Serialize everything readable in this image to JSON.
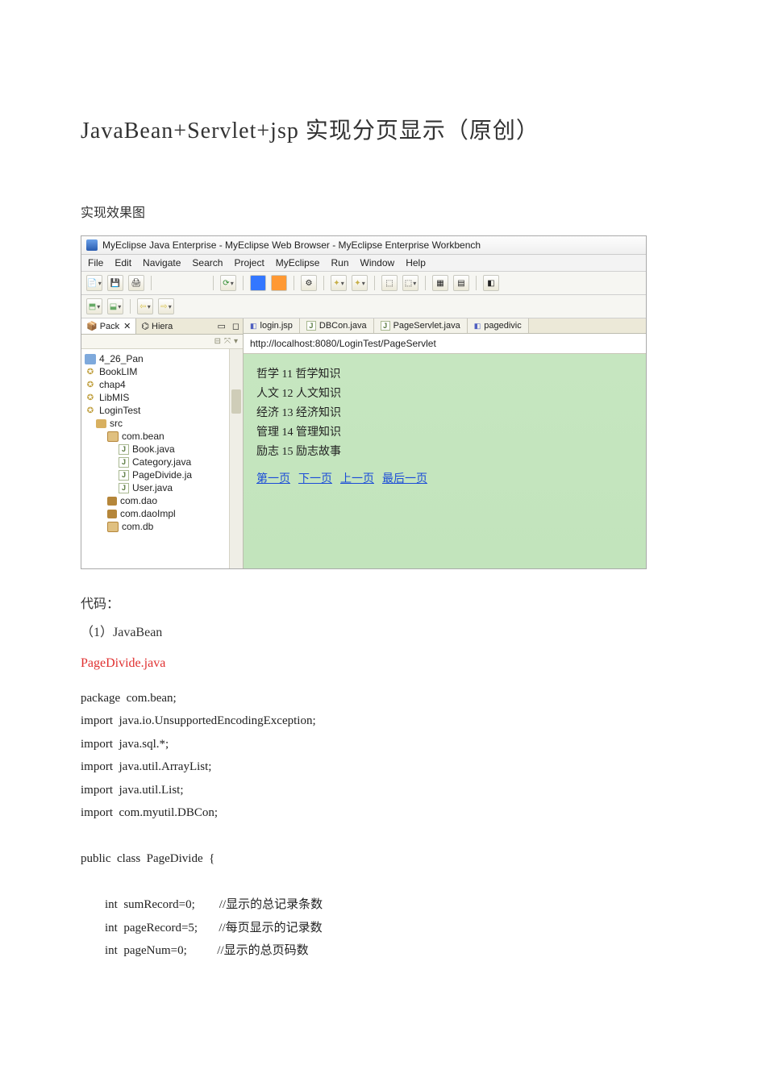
{
  "title": "JavaBean+Servlet+jsp 实现分页显示（原创）",
  "section_effect": "实现效果图",
  "ide": {
    "window_title": "MyEclipse Java Enterprise - MyEclipse Web Browser - MyEclipse Enterprise Workbench",
    "menus": [
      "File",
      "Edit",
      "Navigate",
      "Search",
      "Project",
      "MyEclipse",
      "Run",
      "Window",
      "Help"
    ],
    "left_tabs": {
      "active": "Pack",
      "other": "Hiera"
    },
    "tree": [
      {
        "label": "4_26_Pan",
        "indent": 0,
        "icon": "folder-blue"
      },
      {
        "label": "BookLIM",
        "indent": 0,
        "icon": "proj-icon"
      },
      {
        "label": "chap4",
        "indent": 0,
        "icon": "proj-icon"
      },
      {
        "label": "LibMIS",
        "indent": 0,
        "icon": "proj-icon"
      },
      {
        "label": "LoginTest",
        "indent": 0,
        "icon": "proj-icon"
      },
      {
        "label": "src",
        "indent": 1,
        "icon": "src-icon"
      },
      {
        "label": "com.bean",
        "indent": 2,
        "icon": "pkg-open"
      },
      {
        "label": "Book.java",
        "indent": 3,
        "icon": "java-icon"
      },
      {
        "label": "Category.java",
        "indent": 3,
        "icon": "java-icon"
      },
      {
        "label": "PageDivide.ja",
        "indent": 3,
        "icon": "java-icon"
      },
      {
        "label": "User.java",
        "indent": 3,
        "icon": "java-icon"
      },
      {
        "label": "com.dao",
        "indent": 2,
        "icon": "pkg-brown"
      },
      {
        "label": "com.daoImpl",
        "indent": 2,
        "icon": "pkg-brown"
      },
      {
        "label": "com.db",
        "indent": 2,
        "icon": "pkg-open"
      }
    ],
    "editor_tabs": [
      {
        "label": "login.jsp",
        "kind": "jsp"
      },
      {
        "label": "DBCon.java",
        "kind": "java"
      },
      {
        "label": "PageServlet.java",
        "kind": "java"
      },
      {
        "label": "pagedivic",
        "kind": "jsp"
      }
    ],
    "url": "http://localhost:8080/LoginTest/PageServlet",
    "page_rows": [
      "哲学 11 哲学知识",
      "人文 12 人文知识",
      "经济 13 经济知识",
      "管理 14 管理知识",
      "励志 15 励志故事"
    ],
    "page_links": [
      "第一页",
      "下一页",
      "上一页",
      "最后一页"
    ]
  },
  "section_code": "代码：",
  "item1": "（1）JavaBean",
  "filename": "PageDivide.java",
  "code_lines": [
    "package  com.bean;",
    "import  java.io.UnsupportedEncodingException;",
    "import  java.sql.*;",
    "import  java.util.ArrayList;",
    "import  java.util.List;",
    "import  com.myutil.DBCon;",
    "",
    "public  class  PageDivide  {",
    "",
    "        int  sumRecord=0;        //显示的总记录条数",
    "        int  pageRecord=5;       //每页显示的记录数",
    "        int  pageNum=0;          //显示的总页码数"
  ]
}
